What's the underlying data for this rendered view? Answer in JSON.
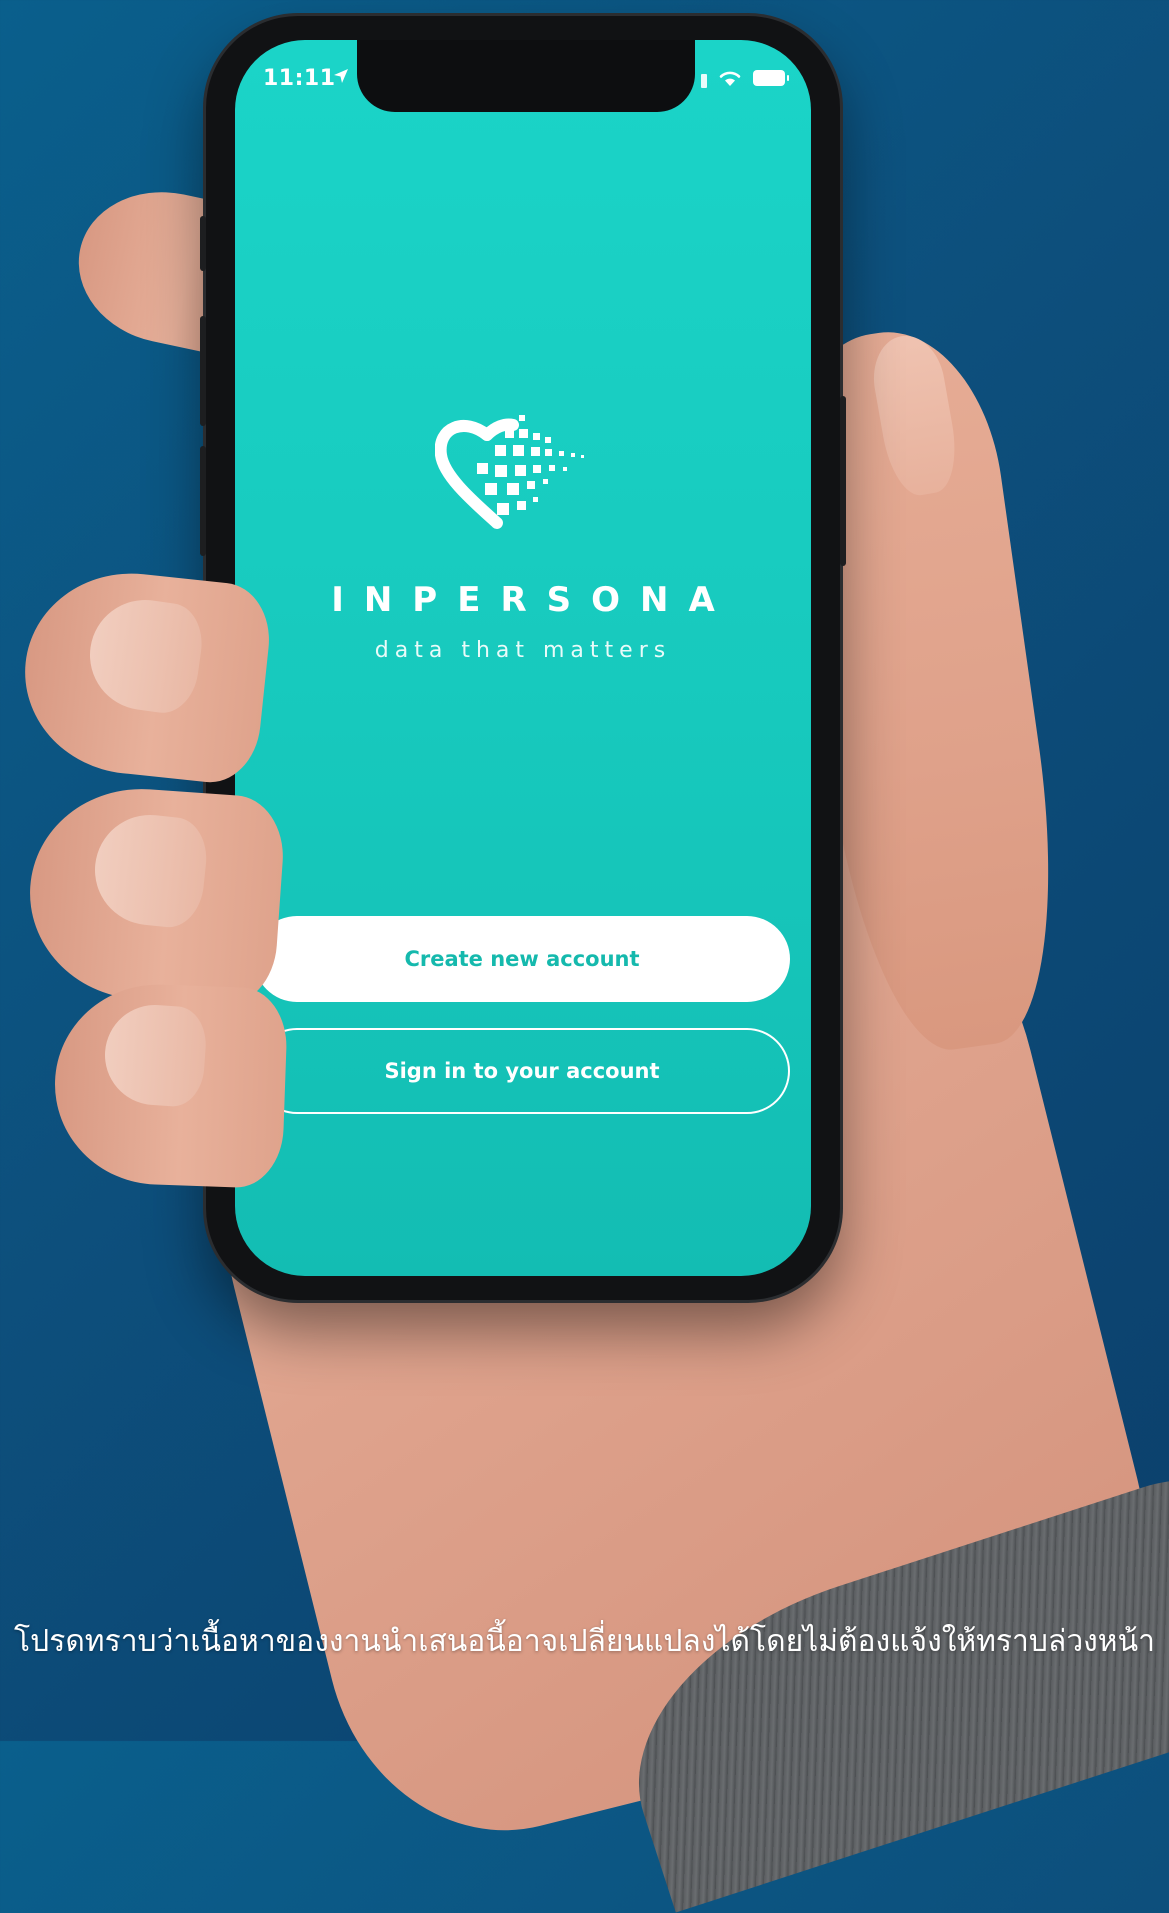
{
  "status_bar": {
    "time": "11:11"
  },
  "icons": {
    "location": "location-arrow-icon",
    "wifi": "wifi-icon",
    "battery": "battery-icon",
    "logo": "pixel-heart-logo-icon"
  },
  "brand": {
    "name": "INPERSONA",
    "tagline": "data that matters"
  },
  "actions": {
    "create_label": "Create new account",
    "signin_label": "Sign in to your account"
  },
  "caption": "โปรดทราบว่าเนื้อหาของงานนำเสนอนี้อาจเปลี่ยนแปลงได้โดยไม่ต้องแจ้งให้ทราบล่วงหน้า",
  "colors": {
    "background": "#0d4f7c",
    "screen_teal": "#1bd4c8",
    "button_text": "#15b9ad",
    "white": "#ffffff"
  }
}
